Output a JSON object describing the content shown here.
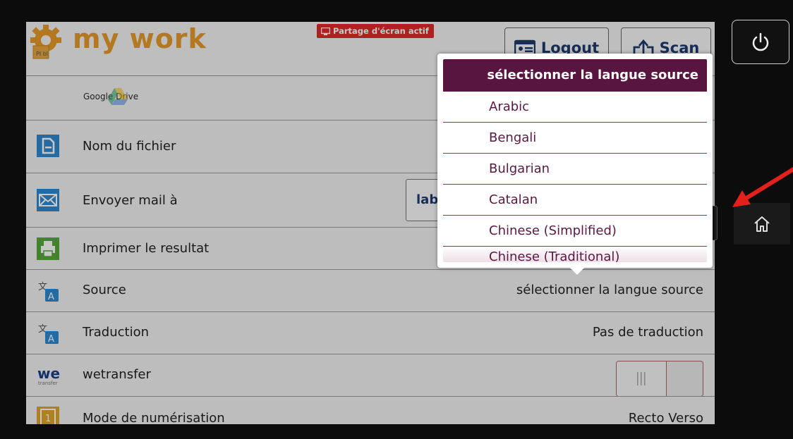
{
  "header": {
    "logo_text": "my work",
    "logo_badge": "PI bl",
    "screen_share_badge": "Partage d'écran actif",
    "logout_label": "Logout",
    "scan_label": "Scan"
  },
  "drive": {
    "label": "Google Drive"
  },
  "rows": {
    "filename": {
      "label": "Nom du fichier"
    },
    "email": {
      "label": "Envoyer mail à",
      "value": "lab"
    },
    "print": {
      "label": "Imprimer le resultat"
    },
    "source": {
      "label": "Source",
      "value": "sélectionner la langue source"
    },
    "translation": {
      "label": "Traduction",
      "value": "Pas de traduction"
    },
    "wetransfer": {
      "label": "wetransfer",
      "icon_text": "we",
      "icon_sub": "transfer",
      "toggle_on": false
    },
    "scan_mode": {
      "label": "Mode de numérisation",
      "value": "Recto Verso",
      "icon_text": "1"
    }
  },
  "dropdown": {
    "title": "sélectionner la langue source",
    "options": [
      "Arabic",
      "Bengali",
      "Bulgarian",
      "Catalan",
      "Chinese (Simplified)",
      "Chinese (Traditional)"
    ]
  },
  "colors": {
    "accent_plum": "#571540",
    "logo_orange": "#e79a2a",
    "badge_red": "#e02b2b",
    "annotation_arrow": "#e3201b"
  }
}
